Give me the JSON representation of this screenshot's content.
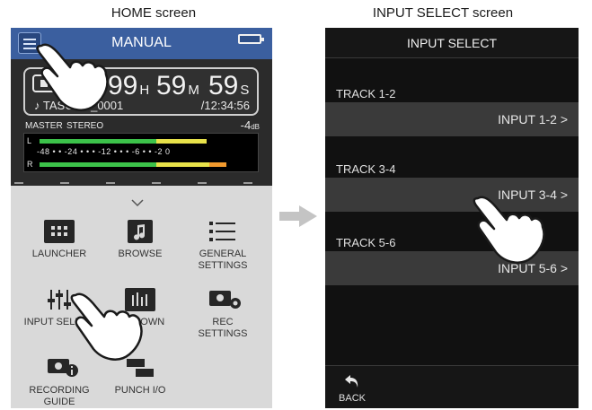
{
  "captions": {
    "home": "HOME screen",
    "input_select": "INPUT SELECT screen"
  },
  "home": {
    "title": "MANUAL",
    "counter": {
      "hours": "99",
      "hours_unit": "H",
      "minutes": "59",
      "minutes_unit": "M",
      "seconds": "59",
      "seconds_unit": "S"
    },
    "filename": "♪ TASCAM_0001",
    "remaining": "/12:34:56",
    "master_label": "MASTER",
    "mode_label": "STEREO",
    "level": "-4",
    "level_unit": "dB",
    "meter": {
      "left_label": "L",
      "right_label": "R",
      "scale": "-48 • • -24 • • • -12 • • • -6 • • -2 0",
      "left_level": 0.79,
      "right_level": 0.88
    },
    "menu_tiles": [
      {
        "label": "LAUNCHER",
        "icon": "grid-icon"
      },
      {
        "label": "BROWSE",
        "icon": "music-note-icon"
      },
      {
        "label": "GENERAL SETTINGS",
        "icon": "list-icon"
      },
      {
        "label": "INPUT SELECT",
        "icon": "mixer-icon"
      },
      {
        "label": "MIXDOWN",
        "icon": "mixdown-icon"
      },
      {
        "label": "REC SETTINGS",
        "icon": "camera-gear-icon"
      },
      {
        "label": "RECORDING GUIDE",
        "icon": "camera-info-icon"
      },
      {
        "label": "PUNCH I/O",
        "icon": "punch-icon"
      }
    ]
  },
  "input_select": {
    "title": "INPUT SELECT",
    "tracks": [
      {
        "track": "TRACK 1-2",
        "input": "INPUT 1-2 >"
      },
      {
        "track": "TRACK 3-4",
        "input": "INPUT 3-4 >"
      },
      {
        "track": "TRACK 5-6",
        "input": "INPUT 5-6 >"
      }
    ],
    "back_label": "BACK"
  },
  "colors": {
    "header_blue": "#3b5f9f",
    "meter_green": "#3cc24a",
    "meter_yellow": "#e8e24a",
    "meter_orange": "#f29a2e",
    "row_gray": "#3a3a3a"
  }
}
